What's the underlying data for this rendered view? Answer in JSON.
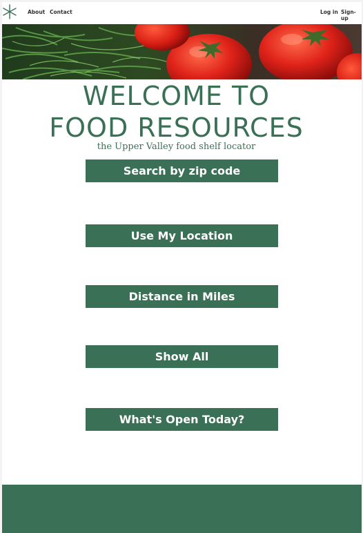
{
  "nav": {
    "logo_icon": "asterisk-logo-icon",
    "about": "About",
    "contact": "Contact",
    "login": "Log in",
    "signup": "Sign-up"
  },
  "hero": {
    "image": "vegetables-tomatoes-greens-banner"
  },
  "header": {
    "title_line1": "WELCOME TO",
    "title_line2": "FOOD RESOURCES",
    "subtitle": "the Upper Valley food shelf locator"
  },
  "buttons": {
    "zip": "Search by zip code",
    "location": "Use My Location",
    "distance": "Distance in Miles",
    "all": "Show All",
    "open": "What's Open Today?"
  },
  "colors": {
    "brand_green": "#3a7056",
    "background": "#ffffff"
  }
}
